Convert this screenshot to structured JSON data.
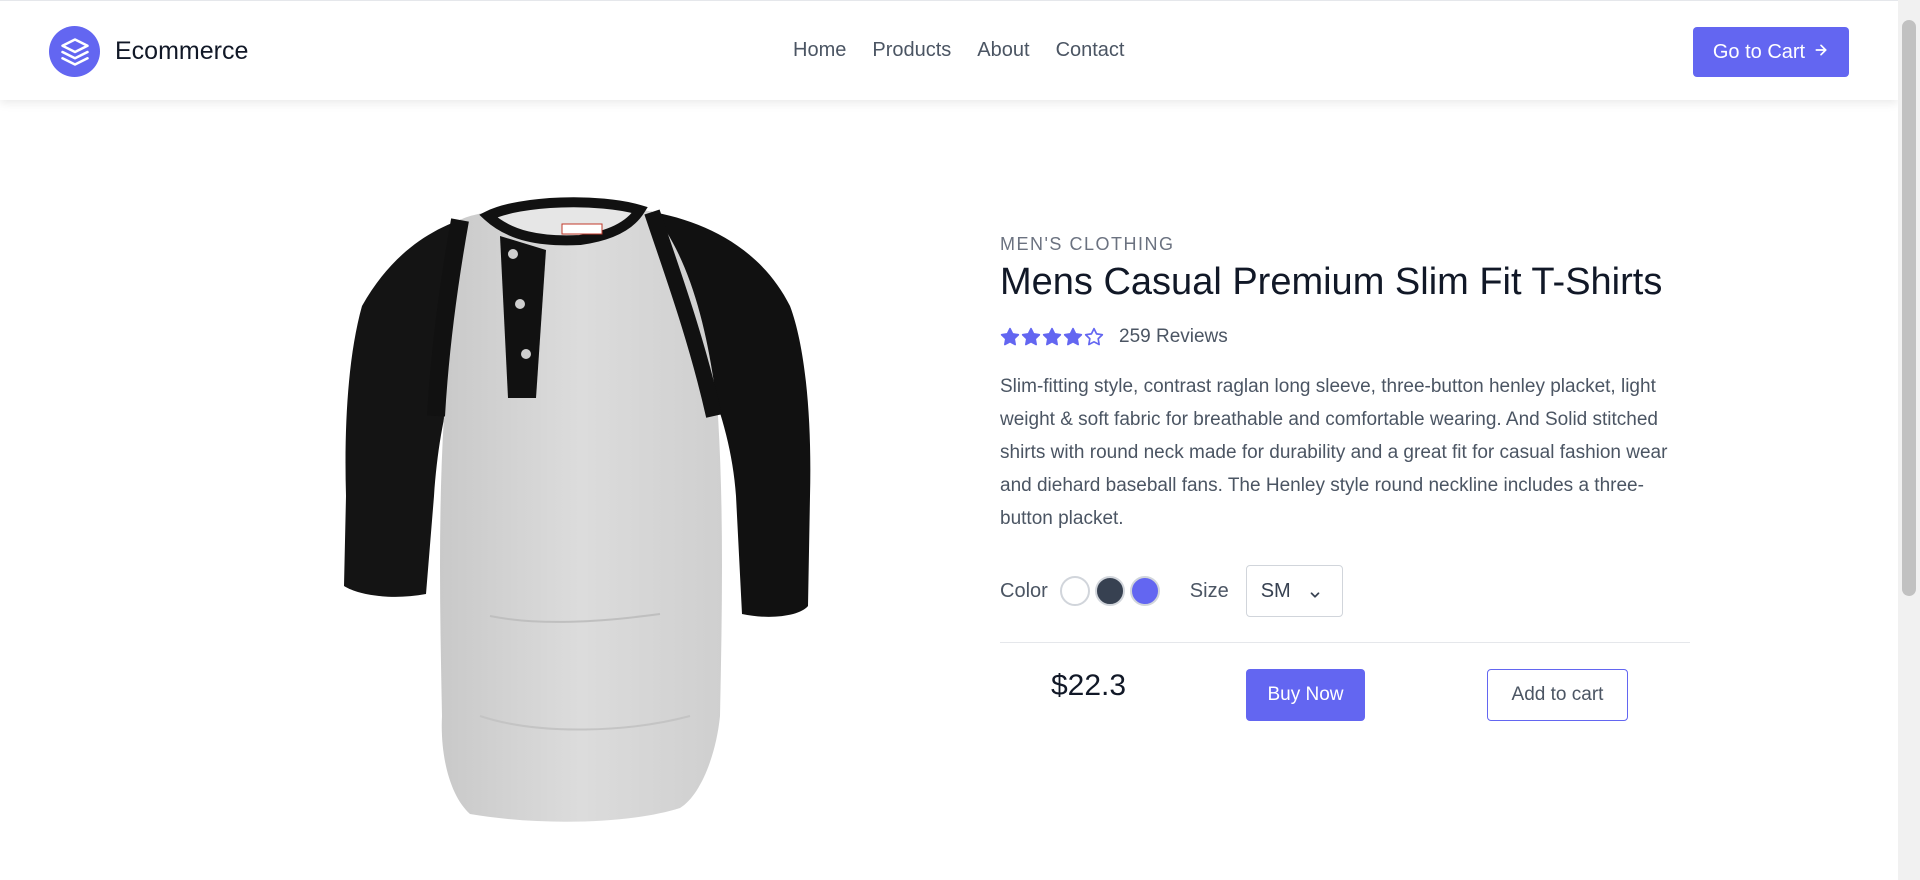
{
  "header": {
    "brand_name": "Ecommerce",
    "brand_icon": "layers-icon",
    "nav": [
      {
        "label": "Home"
      },
      {
        "label": "Products"
      },
      {
        "label": "About"
      },
      {
        "label": "Contact"
      }
    ],
    "cart_button_label": "Go to Cart",
    "cart_button_icon": "arrow-right-icon"
  },
  "product": {
    "category": "MEN'S CLOTHING",
    "title": "Mens Casual Premium Slim Fit T-Shirts",
    "rating": {
      "filled_stars": 4,
      "max_stars": 5
    },
    "reviews_label": "259 Reviews",
    "description": "Slim-fitting style, contrast raglan long sleeve, three-button henley placket, light weight & soft fabric for breathable and comfortable wearing. And Solid stitched shirts with round neck made for durability and a great fit for casual fashion wear and diehard baseball fans. The Henley style round neckline includes a three-button placket.",
    "color_label": "Color",
    "colors": [
      "#ffffff",
      "#374151",
      "#6366f1"
    ],
    "size_label": "Size",
    "size_selected": "SM",
    "price": "$22.3",
    "buy_label": "Buy Now",
    "add_label": "Add to cart"
  },
  "colors": {
    "accent": "#6366f1"
  }
}
